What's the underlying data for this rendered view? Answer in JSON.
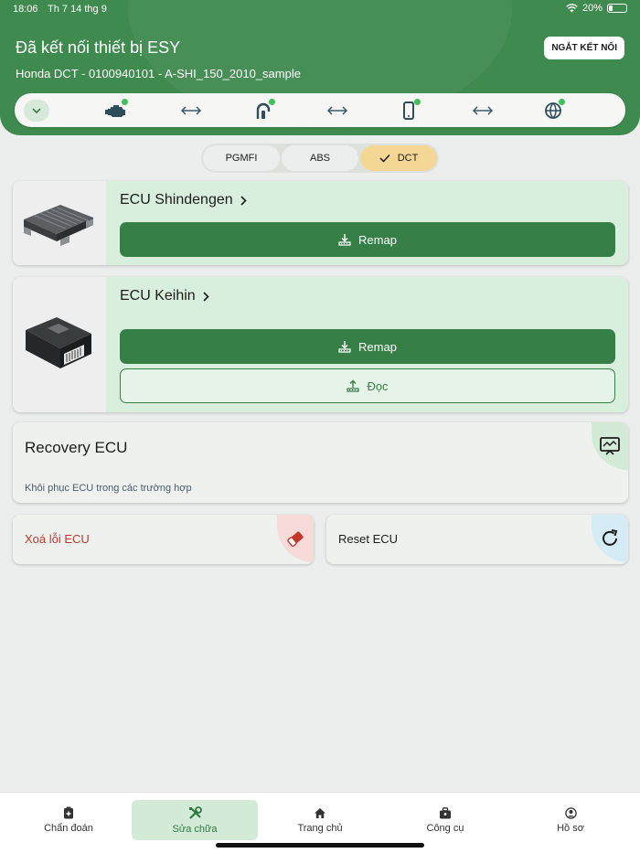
{
  "status_bar": {
    "time": "18:06",
    "date": "Th 7 14 thg 9",
    "battery": "20%",
    "battery_level": 0.2
  },
  "header": {
    "title": "Đã kết nối thiết bị ESY",
    "subtitle": "Honda DCT - 0100940101 - A-SHI_150_2010_sample",
    "disconnect_label": "NGẮT KẾT NỐI",
    "connection_icons": [
      "chevron-down-icon",
      "engine-icon",
      "arrow-left-right-icon",
      "obd-connector-icon",
      "arrow-left-right-icon",
      "phone-icon",
      "arrow-left-right-icon",
      "globe-icon"
    ]
  },
  "segments": [
    {
      "label": "PGMFI",
      "active": false
    },
    {
      "label": "ABS",
      "active": false
    },
    {
      "label": "DCT",
      "active": true
    }
  ],
  "ecus": [
    {
      "name": "ECU Shindengen",
      "buttons": [
        {
          "label": "Remap",
          "icon": "download-icon"
        }
      ]
    },
    {
      "name": "ECU Keihin",
      "buttons": [
        {
          "label": "Remap",
          "icon": "download-icon"
        },
        {
          "label": "Đọc",
          "icon": "upload-icon"
        }
      ]
    }
  ],
  "recovery": {
    "title": "Recovery ECU",
    "description": "Khôi phục ECU trong các trường hợp",
    "icon": "monitor-chart-icon"
  },
  "actions": [
    {
      "label": "Xoá lỗi ECU",
      "icon": "eraser-icon",
      "color": "#c0392b"
    },
    {
      "label": "Reset ECU",
      "icon": "refresh-icon",
      "color": "#1c1c1c"
    }
  ],
  "nav": [
    {
      "label": "Chẩn đoán",
      "icon": "clipboard-icon",
      "active": false
    },
    {
      "label": "Sửa chữa",
      "icon": "tools-icon",
      "active": true
    },
    {
      "label": "Trang chủ",
      "icon": "home-icon",
      "active": false
    },
    {
      "label": "Công cụ",
      "icon": "toolbox-icon",
      "active": false
    },
    {
      "label": "Hồ sơ",
      "icon": "user-circle-icon",
      "active": false
    }
  ],
  "colors": {
    "primary": "#3f8a4e",
    "button": "#367f46",
    "accent_active": "#f5d795",
    "danger": "#c0392b"
  }
}
